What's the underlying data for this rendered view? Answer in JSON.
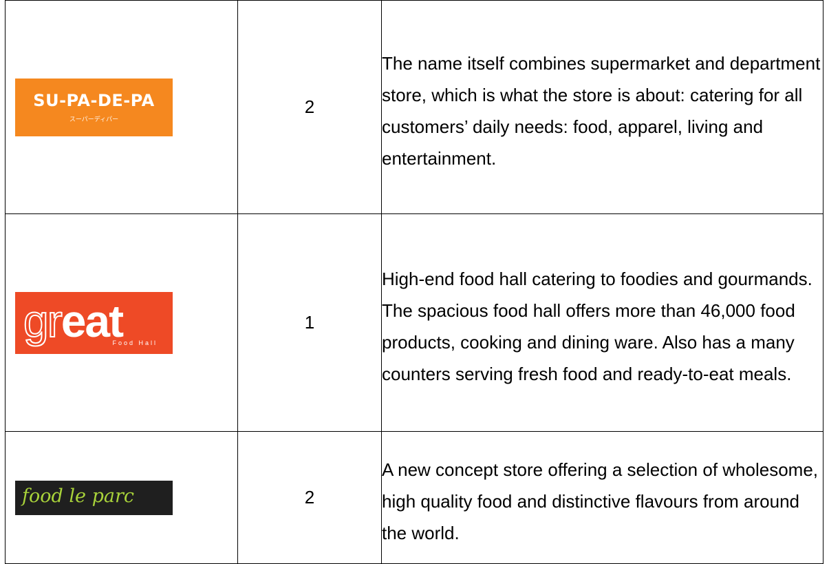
{
  "rows": [
    {
      "logo": {
        "icon": "supadepa-logo",
        "text": "SU-PA-DE-PA",
        "subtext": "スーパーディパー",
        "color": "#f5881f"
      },
      "number": "2",
      "description": "The name itself combines supermarket and department store, which is what the store is about: catering for all customers’ daily needs: food, apparel, living and entertainment."
    },
    {
      "logo": {
        "icon": "great-food-hall-logo",
        "text_prefix": "gr",
        "text_suffix": "eat",
        "subtext": "Food Hall",
        "color": "#ee4a26"
      },
      "number": "1",
      "description": "High-end food hall catering to foodies and gourmands. The spacious food hall offers more than 46,000 food products, cooking and dining ware. Also has a many counters serving fresh food and ready-to-eat meals."
    },
    {
      "logo": {
        "icon": "food-le-parc-logo",
        "text": "food le parc",
        "color": "#1f1f1f"
      },
      "number": "2",
      "description": "A new concept store offering a selection of wholesome, high quality food and distinctive flavours from around the world."
    }
  ]
}
